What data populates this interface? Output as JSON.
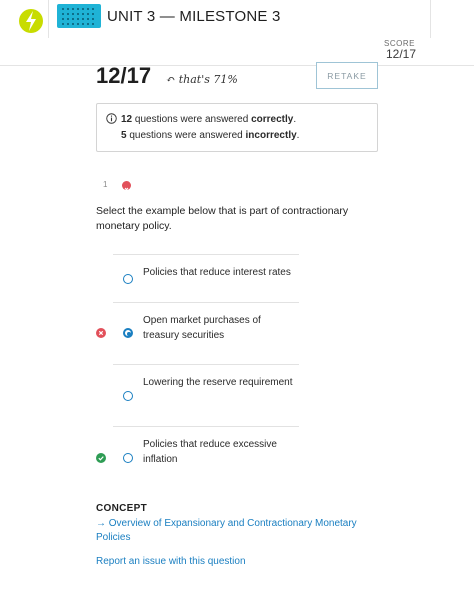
{
  "header": {
    "unit_title": "UNIT 3 — MILESTONE 3",
    "score_label": "SCORE",
    "score_value": "12/17"
  },
  "result": {
    "score": "12/17",
    "percent_note": "↶ that's 71%",
    "retake_label": "RETAKE"
  },
  "summary": {
    "correct_count": "12",
    "correct_text": " questions were answered ",
    "correct_word": "correctly",
    "incorrect_count": "5",
    "incorrect_text": " questions were answered ",
    "incorrect_word": "incorrectly",
    "period": "."
  },
  "question": {
    "number": "1",
    "text": "Select the example below that is part of contractionary monetary policy.",
    "options": [
      {
        "label": "Policies that reduce interest rates",
        "selected": false,
        "mark": "none"
      },
      {
        "label": "Open market purchases of treasury securities",
        "selected": true,
        "mark": "wrong"
      },
      {
        "label": "Lowering the reserve requirement",
        "selected": false,
        "mark": "none"
      },
      {
        "label": "Policies that reduce excessive inflation",
        "selected": false,
        "mark": "right"
      }
    ]
  },
  "concept": {
    "label": "CONCEPT",
    "link_text": "→ Overview of Expansionary and Contractionary Monetary Policies"
  },
  "report_link": "Report an issue with this question",
  "colors": {
    "accent": "#1a7fc1",
    "logo": "#c8dc00",
    "unit_icon": "#1fb3d6",
    "wrong": "#e2505a",
    "right": "#2e9c54"
  }
}
